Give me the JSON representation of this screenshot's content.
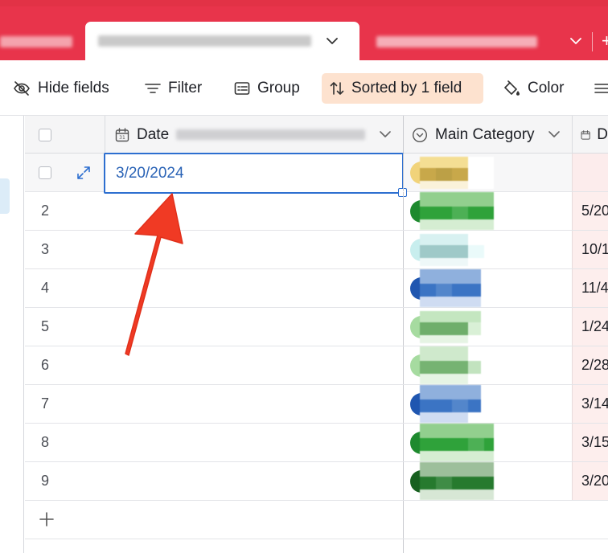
{
  "tabs": {
    "active_chevron": "chevron-down",
    "right_chevron": "chevron-down",
    "add": "+"
  },
  "toolbar": {
    "hide_fields": "Hide fields",
    "filter": "Filter",
    "group": "Group",
    "sorted": "Sorted by 1 field",
    "color": "Color"
  },
  "columns": {
    "date": "Date",
    "main_category": "Main Category",
    "next_initial": "D"
  },
  "rows": [
    {
      "num": "",
      "date": "3/20/2024",
      "next": ""
    },
    {
      "num": "2",
      "date": "",
      "next": "5/20"
    },
    {
      "num": "3",
      "date": "",
      "next": "10/1"
    },
    {
      "num": "4",
      "date": "",
      "next": "11/4"
    },
    {
      "num": "5",
      "date": "",
      "next": "1/24"
    },
    {
      "num": "6",
      "date": "",
      "next": "2/28"
    },
    {
      "num": "7",
      "date": "",
      "next": "3/14"
    },
    {
      "num": "8",
      "date": "",
      "next": "3/15"
    },
    {
      "num": "9",
      "date": "",
      "next": "3/20"
    }
  ],
  "colors": {
    "tabbar": "#e8344b",
    "sort_highlight": "#fde2cf",
    "selection": "#2d6fd0",
    "arrow": "#f03a24"
  }
}
